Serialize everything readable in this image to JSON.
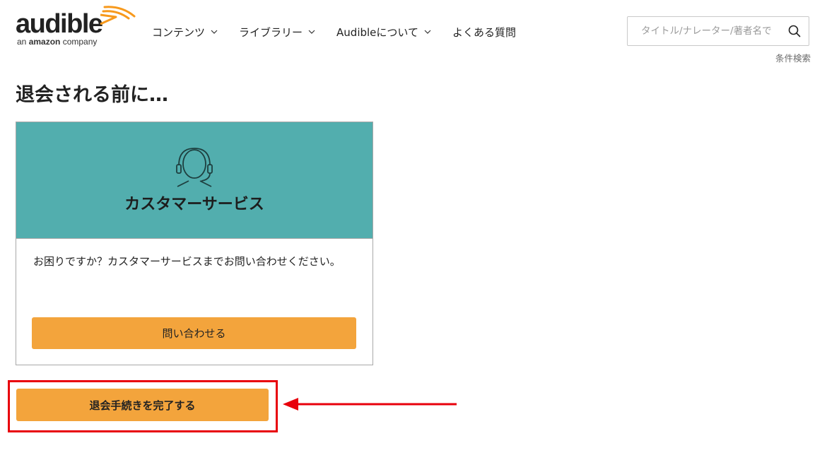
{
  "logo": {
    "word": "audible",
    "sub_prefix": "an ",
    "sub_brand": "amazon",
    "sub_suffix": " company",
    "color_wave": "#f7991c"
  },
  "nav": {
    "items": [
      {
        "label": "コンテンツ",
        "has_dropdown": true
      },
      {
        "label": "ライブラリー",
        "has_dropdown": true
      },
      {
        "label": "Audibleについて",
        "has_dropdown": true
      },
      {
        "label": "よくある質問",
        "has_dropdown": false
      }
    ]
  },
  "search": {
    "placeholder": "タイトル/ナレーター/著者名で",
    "value": "",
    "advanced_label": "条件検索"
  },
  "page": {
    "title": "退会される前に…"
  },
  "card": {
    "icon": "headset-icon",
    "title": "カスタマーサービス",
    "text": "お困りですか？カスタマーサービスまでお問い合わせください。",
    "button_label": "問い合わせる",
    "header_color": "#52aeae"
  },
  "cancel": {
    "button_label": "退会手続きを完了する",
    "button_color": "#f3a43c",
    "highlight_color": "#e8000b"
  }
}
